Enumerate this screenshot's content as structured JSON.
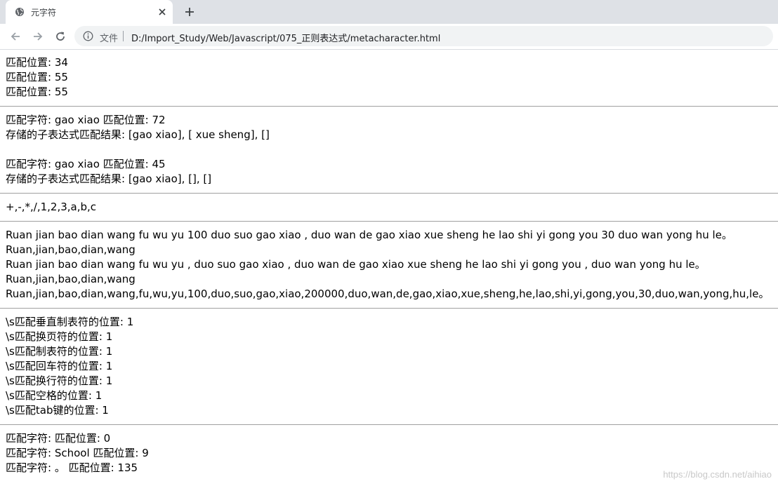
{
  "tab": {
    "title": "元字符"
  },
  "address_bar": {
    "security_label": "文件",
    "url": "D:/Import_Study/Web/Javascript/075_正则表达式/metacharacter.html"
  },
  "sections": [
    {
      "lines": [
        "匹配位置: 34",
        "匹配位置: 55",
        "匹配位置: 55"
      ]
    },
    {
      "lines": [
        "匹配字符: gao xiao 匹配位置: 72",
        "存储的子表达式匹配结果: [gao xiao], [ xue sheng], []",
        "",
        "匹配字符: gao xiao 匹配位置: 45",
        "存储的子表达式匹配结果: [gao xiao], [], []"
      ]
    },
    {
      "lines": [
        "+,-,*,/,1,2,3,a,b,c"
      ]
    },
    {
      "lines": [
        "Ruan jian bao dian wang fu wu yu 100 duo suo gao xiao , duo wan de gao xiao xue sheng he lao shi yi gong you 30 duo wan yong hu le。",
        "Ruan,jian,bao,dian,wang",
        "Ruan jian bao dian wang fu wu yu , duo suo gao xiao , duo wan de gao xiao xue sheng he lao shi yi gong you , duo wan yong hu le。",
        "Ruan,jian,bao,dian,wang",
        "Ruan,jian,bao,dian,wang,fu,wu,yu,100,duo,suo,gao,xiao,200000,duo,wan,de,gao,xiao,xue,sheng,he,lao,shi,yi,gong,you,30,duo,wan,yong,hu,le。"
      ]
    },
    {
      "lines": [
        "\\s匹配垂直制表符的位置: 1",
        "\\s匹配换页符的位置: 1",
        "\\s匹配制表符的位置: 1",
        "\\s匹配回车符的位置: 1",
        "\\s匹配换行符的位置: 1",
        "\\s匹配空格的位置: 1",
        "\\s匹配tab键的位置: 1"
      ]
    },
    {
      "lines": [
        "匹配字符: 匹配位置: 0",
        "匹配字符: School 匹配位置: 9",
        "匹配字符: 。 匹配位置: 135"
      ]
    }
  ],
  "watermark": "https://blog.csdn.net/aihiao"
}
